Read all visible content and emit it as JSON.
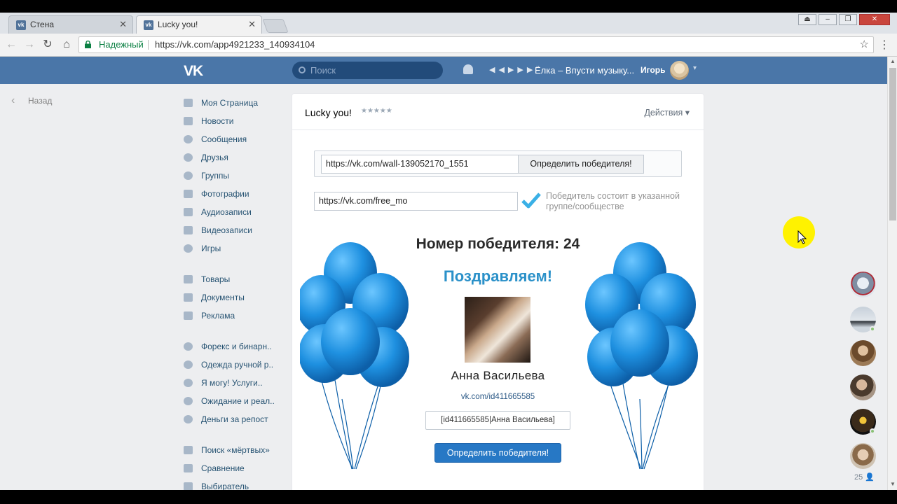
{
  "browser": {
    "tabs": [
      {
        "label": "Стена",
        "favicon": "vk-icon"
      },
      {
        "label": "Lucky you!",
        "favicon": "vk-app-icon"
      }
    ],
    "secure_label": "Надежный",
    "url": "https://vk.com/app4921233_140934104"
  },
  "header": {
    "logo": "VK",
    "search_placeholder": "Поиск",
    "track": "Ёлка – Впусти музыку...",
    "user_name": "Игорь"
  },
  "back_label": "Назад",
  "nav": {
    "main": [
      "Моя Страница",
      "Новости",
      "Сообщения",
      "Друзья",
      "Группы",
      "Фотографии",
      "Аудиозаписи",
      "Видеозаписи",
      "Игры"
    ],
    "extra": [
      "Товары",
      "Документы",
      "Реклама"
    ],
    "groups": [
      "Форекс и бинарн..",
      "Одежда ручной р..",
      "Я могу! Услуги..",
      "Ожидание и реал..",
      "Деньги за репост"
    ],
    "apps": [
      "Поиск «мёртвых»",
      "Сравнение",
      "Выбиратель"
    ]
  },
  "app": {
    "title": "Lucky you!",
    "rating_stars": "★★★★★",
    "actions_label": "Действия",
    "post_url": "https://vk.com/wall-139052170_1551",
    "determine_button": "Определить победителя!",
    "group_url": "https://vk.com/free_mo",
    "group_hint": "Победитель состоит в указанной группе/сообществе",
    "winner_number_text": "Номер победителя: 24",
    "congrats": "Поздравляем!",
    "winner_name": "Анна Васильева",
    "winner_link": "vk.com/id411665585",
    "winner_code": "[id411665585|Анна Васильева]",
    "determine_button_2": "Определить победителя!"
  },
  "dock": {
    "count": "25"
  },
  "colors": {
    "vk_blue": "#4a76a8",
    "accent": "#2778c5",
    "congrats": "#2b91c9",
    "balloon": "#1e90e0"
  }
}
